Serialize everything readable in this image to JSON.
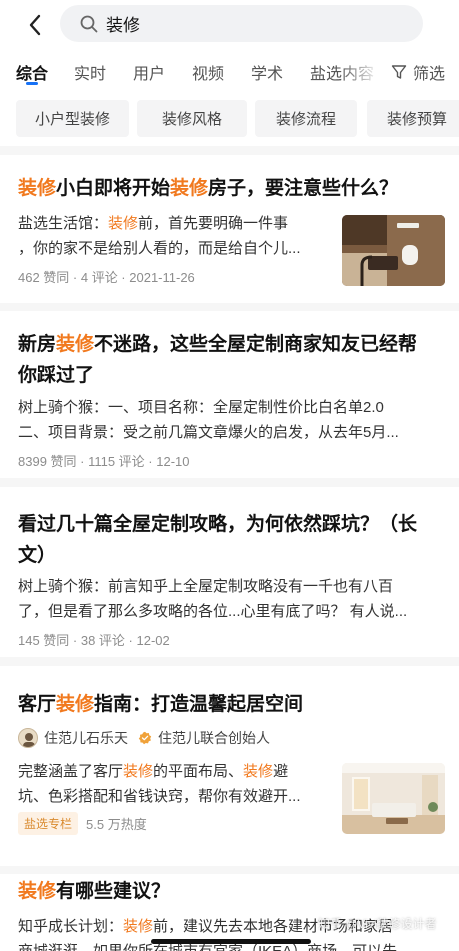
{
  "search": {
    "query": "装修"
  },
  "tabs": [
    {
      "label": "综合"
    },
    {
      "label": "实时"
    },
    {
      "label": "用户"
    },
    {
      "label": "视频"
    },
    {
      "label": "学术"
    },
    {
      "label": "盐选内容"
    }
  ],
  "filter_label": "筛选",
  "chips": [
    {
      "label": "小户型装修"
    },
    {
      "label": "装修风格"
    },
    {
      "label": "装修流程"
    },
    {
      "label": "装修预算"
    }
  ],
  "results": [
    {
      "title_parts": [
        "装修",
        "小白即将开始",
        "装修",
        "房子，要注意些什么？"
      ],
      "excerpt_line1_parts": [
        "盐选生活馆：",
        "装修",
        "前，首先要明确一件事"
      ],
      "excerpt_line2": "，你的家不是给别人看的，而是给自个儿...",
      "meta": "462 赞同 · 4 评论 · 2021-11-26"
    },
    {
      "title_line1_parts": [
        "新房",
        "装修",
        "不迷路，这些全屋定制商家知友已经帮"
      ],
      "title_line2": "你踩过了",
      "excerpt_line1": "树上骑个猴：一、项目名称：全屋定制性价比白名单2.0",
      "excerpt_line2": "二、项目背景：受之前几篇文章爆火的启发，从去年5月...",
      "meta": "8399 赞同 · 1115 评论 · 12-10"
    },
    {
      "title_line1": "看过几十篇全屋定制攻略，为何依然踩坑？（长",
      "title_line2": "文）",
      "excerpt_line1": "树上骑个猴：前言知乎上全屋定制攻略没有一千也有八百",
      "excerpt_line2": "了，但是看了那么多攻略的各位...心里有底了吗？ 有人说...",
      "meta": "145 赞同 · 38 评论 · 12-02"
    },
    {
      "title_parts": [
        "客厅",
        "装修",
        "指南：打造温馨起居空间"
      ],
      "author_name": "住范儿石乐天",
      "author_title": "住范儿联合创始人",
      "excerpt_line1_parts": [
        "完整涵盖了客厅",
        "装修",
        "的平面布局、",
        "装修",
        "避"
      ],
      "excerpt_line2": "坑、色彩搭配和省钱诀窍，帮你有效避开...",
      "column_badge": "盐选专栏",
      "heat": "5.5 万热度"
    },
    {
      "title_parts": [
        "装修",
        "有哪些建议？"
      ],
      "excerpt_line1_parts": [
        "知乎成长计划：",
        "装修",
        "前，建议先去本地各建材市场和家居"
      ],
      "excerpt_line2": "商城逛逛，如果你所在城市有宜家（IKEA）商场，可以先"
    }
  ],
  "watermark": "知乎 @Vivi装修设计者",
  "colors": {
    "highlight": "#f1791e",
    "accent": "#1772f6"
  }
}
